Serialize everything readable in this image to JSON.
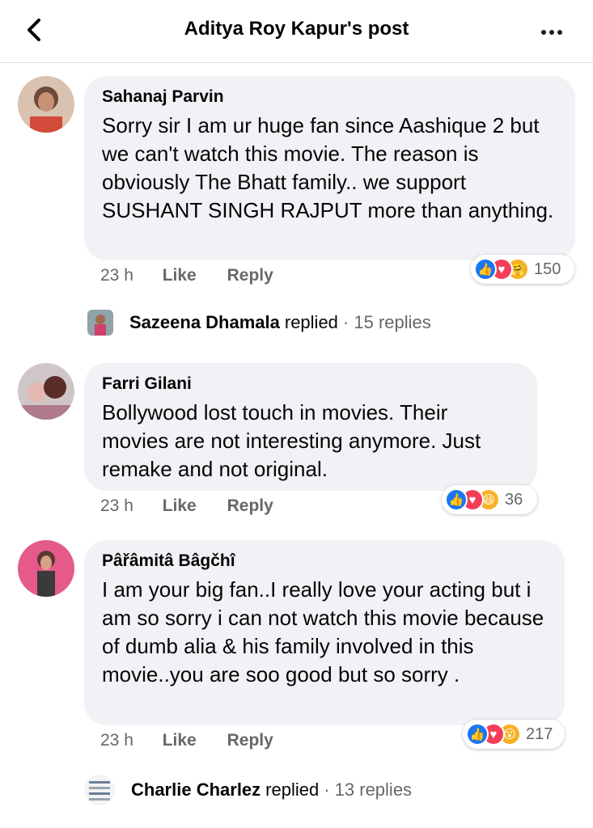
{
  "header": {
    "title": "Aditya Roy Kapur's post"
  },
  "comments": [
    {
      "author": "Sahanaj Parvin",
      "text": "Sorry sir I am ur huge fan since Aashique 2 but we can't watch this movie. The reason is obviously The Bhatt family.. we support SUSHANT SINGH RAJPUT more than anything.",
      "time": "23 h",
      "like_label": "Like",
      "reply_label": "Reply",
      "reaction_count": "150",
      "reactions": [
        "like",
        "love",
        "care"
      ]
    },
    {
      "author": "Farri Gilani",
      "text": "Bollywood lost touch in movies. Their movies are not interesting anymore. Just remake and not original.",
      "time": "23 h",
      "like_label": "Like",
      "reply_label": "Reply",
      "reaction_count": "36",
      "reactions": [
        "like",
        "love",
        "haha"
      ]
    },
    {
      "author": "Pâřâmitâ Bâgčhî",
      "text": "I am your big fan..I really love your acting but i am so sorry i can not watch this movie because of dumb alia & his family involved in this movie..you are soo good but so sorry .",
      "time": "23 h",
      "like_label": "Like",
      "reply_label": "Reply",
      "reaction_count": "217",
      "reactions": [
        "like",
        "love",
        "wow"
      ]
    }
  ],
  "replies": [
    {
      "name": "Sazeena Dhamala",
      "verb": "replied",
      "count": "· 15 replies"
    },
    {
      "name": "Charlie Charlez",
      "verb": "replied",
      "count": "· 13 replies"
    }
  ]
}
